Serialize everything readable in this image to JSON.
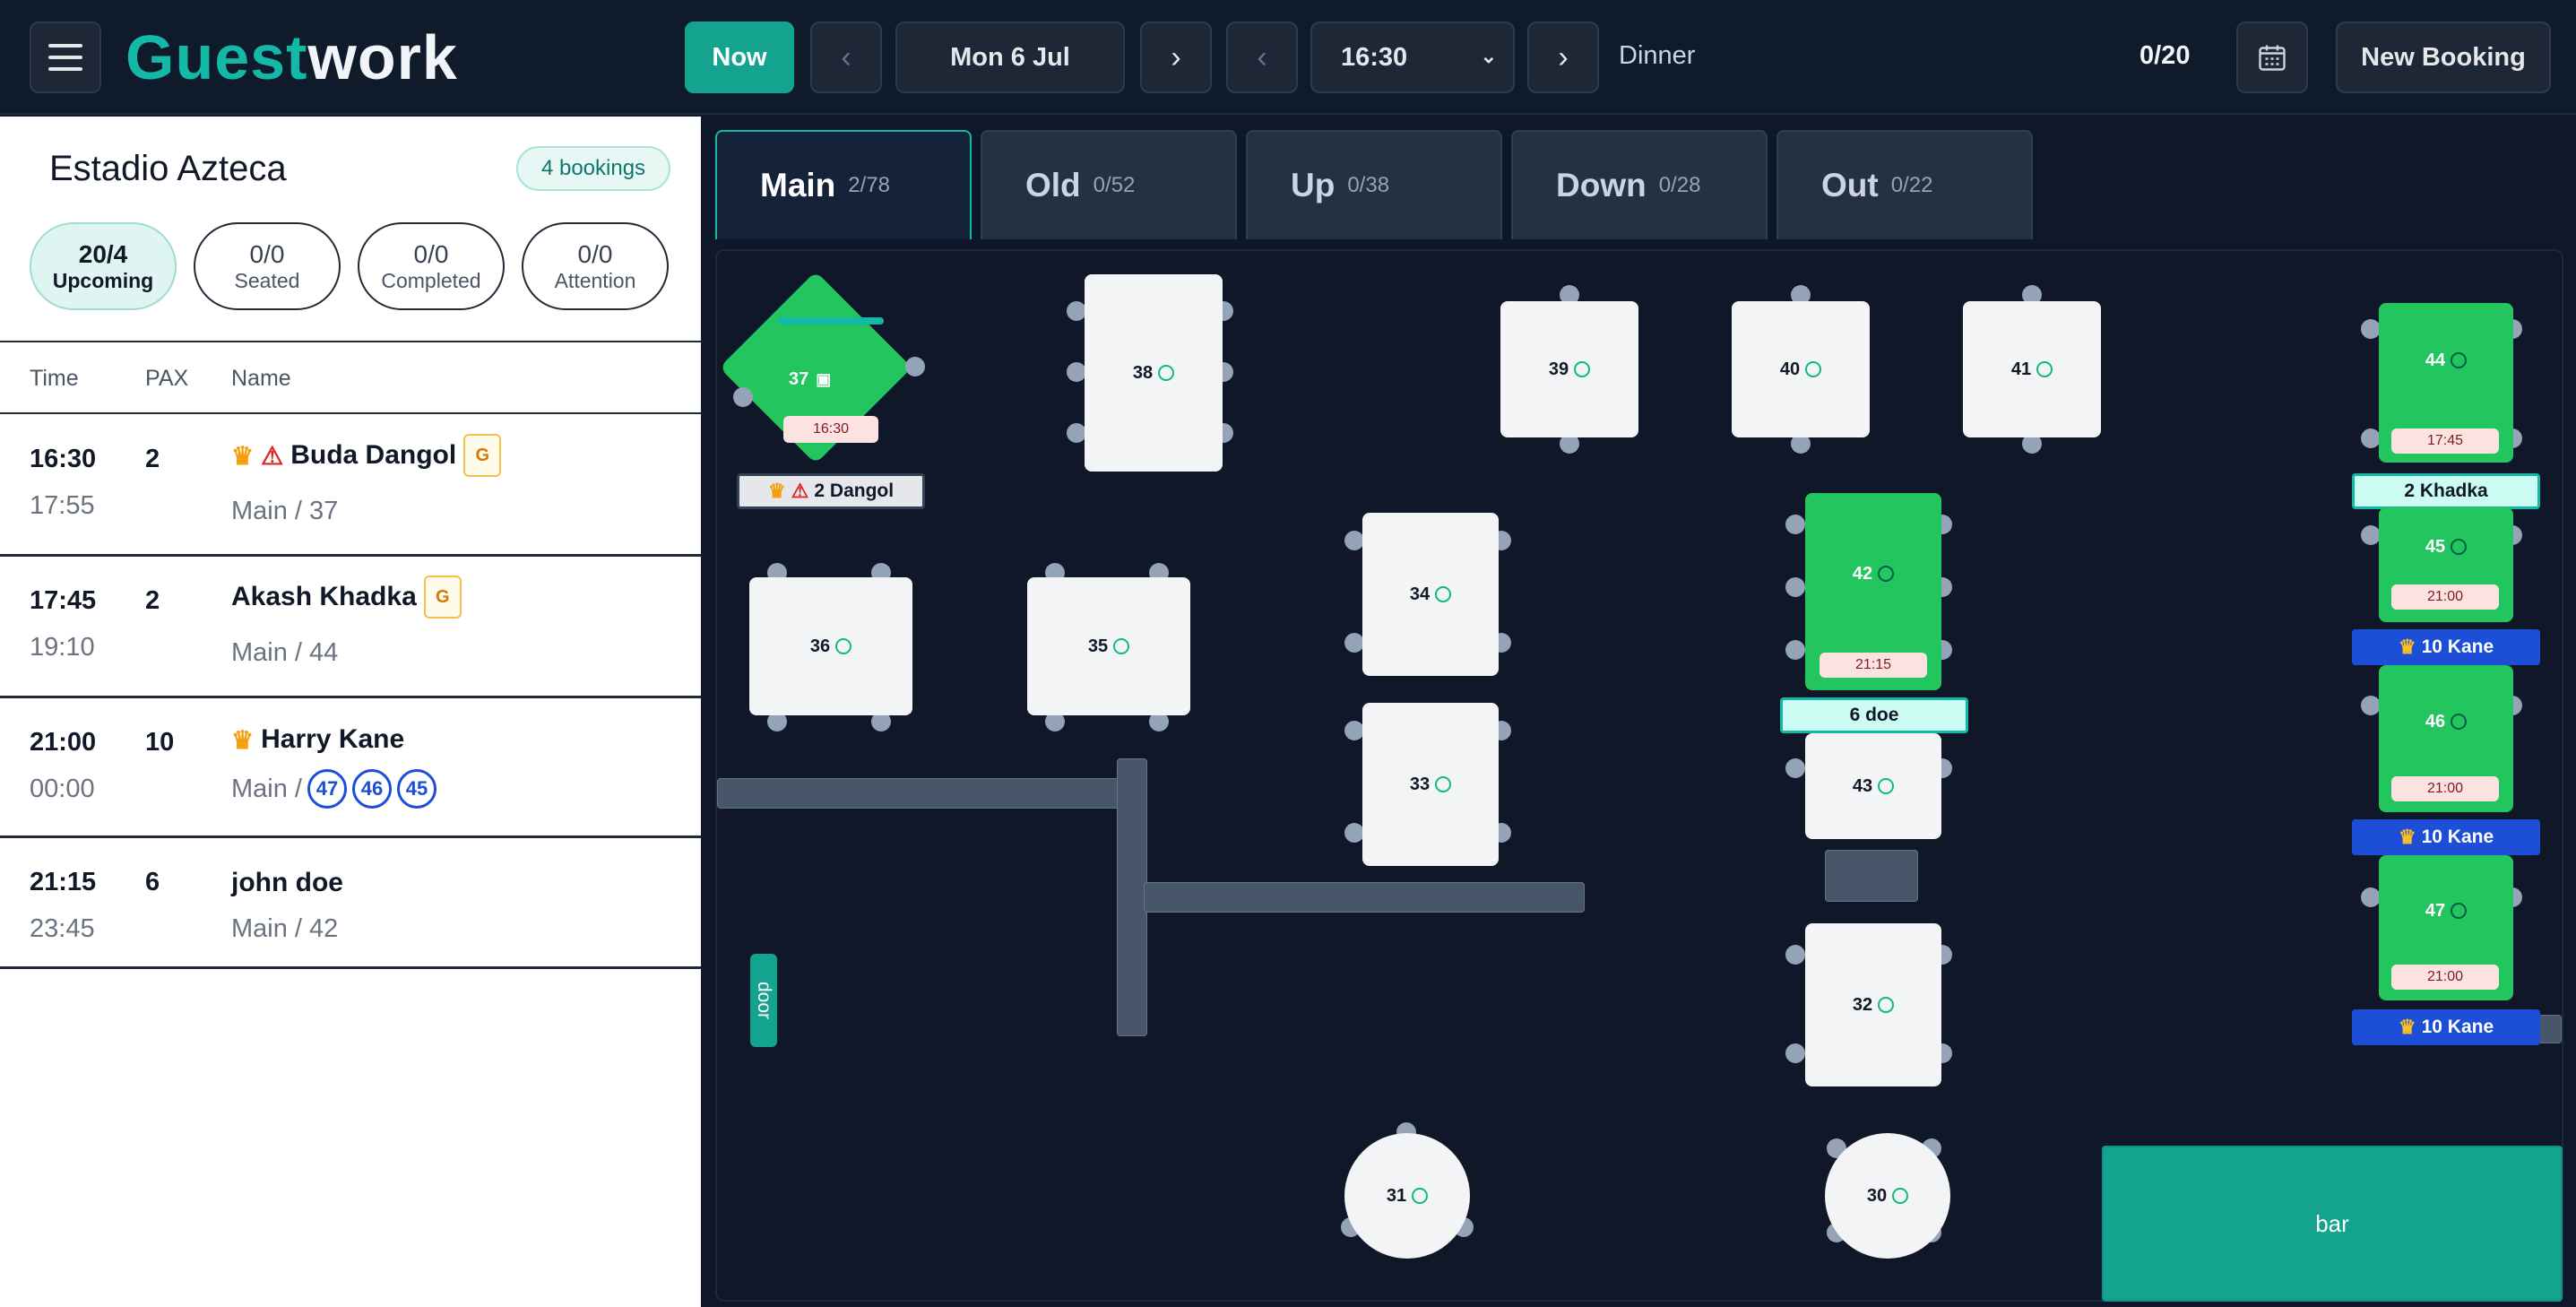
{
  "app": {
    "logo_part1": "Guest",
    "logo_part2": "work"
  },
  "toolbar": {
    "now_label": "Now",
    "prev_day": "‹",
    "date": "Mon 6 Jul",
    "next_day": "›",
    "prev_time": "‹",
    "time": "16:30",
    "next_time": "›",
    "service": "Dinner",
    "covers": "0/20",
    "new_booking": "New Booking"
  },
  "venue": {
    "name": "Estadio Azteca",
    "bookings_count": "4 bookings"
  },
  "stats": [
    {
      "value": "20/4",
      "label": "Upcoming"
    },
    {
      "value": "0/0",
      "label": "Seated"
    },
    {
      "value": "0/0",
      "label": "Completed"
    },
    {
      "value": "0/0",
      "label": "Attention"
    }
  ],
  "columns": {
    "time": "Time",
    "pax": "PAX",
    "name": "Name"
  },
  "bookings": [
    {
      "time": "16:30",
      "end": "17:55",
      "pax": "2",
      "name": "Buda Dangol",
      "badge": "G",
      "loc": "Main / 37"
    },
    {
      "time": "17:45",
      "end": "19:10",
      "pax": "2",
      "name": "Akash Khadka",
      "badge": "G",
      "loc": "Main / 44"
    },
    {
      "time": "21:00",
      "end": "00:00",
      "pax": "10",
      "name": "Harry Kane",
      "loc": "Main /",
      "tables": [
        "47",
        "46",
        "45"
      ]
    },
    {
      "time": "21:15",
      "end": "23:45",
      "pax": "6",
      "name": "john doe",
      "loc": "Main / 42"
    }
  ],
  "tabs": [
    {
      "name": "Main",
      "count": "2/78"
    },
    {
      "name": "Old",
      "count": "0/52"
    },
    {
      "name": "Up",
      "count": "0/38"
    },
    {
      "name": "Down",
      "count": "0/28"
    },
    {
      "name": "Out",
      "count": "0/22"
    }
  ],
  "tables": {
    "t37": {
      "num": "37",
      "time": "16:30"
    },
    "t38": "38",
    "t39": "39",
    "t40": "40",
    "t41": "41",
    "t44": {
      "num": "44",
      "time": "17:45"
    },
    "t45": {
      "num": "45",
      "time": "21:00"
    },
    "t46": {
      "num": "46",
      "time": "21:00"
    },
    "t47": {
      "num": "47",
      "time": "21:00"
    },
    "t42": {
      "num": "42",
      "time": "21:15"
    },
    "t43": "43",
    "t36": "36",
    "t35": "35",
    "t34": "34",
    "t33": "33",
    "t32": "32",
    "t31": "31",
    "t30": "30"
  },
  "tags": {
    "dangol": "2 Dangol",
    "khadka": "2 Khadka",
    "doe": "6 doe",
    "kane1": "10 Kane",
    "kane2": "10 Kane",
    "kane3": "10 Kane"
  },
  "areas": {
    "door": "door",
    "bar": "bar"
  },
  "colors": {
    "accent": "#14b8a6",
    "occupied": "#22c55e",
    "kane_tag": "#1d4ed8"
  }
}
